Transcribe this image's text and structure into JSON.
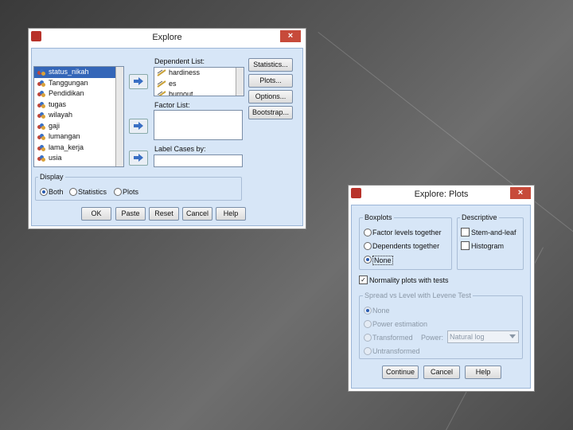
{
  "explore": {
    "title": "Explore",
    "close_label": "×",
    "variables": [
      "status_nikah",
      "Tanggungan",
      "Pendidikan",
      "tugas",
      "wilayah",
      "gaji",
      "lumangan",
      "lama_kerja",
      "usia"
    ],
    "dependent_list_label": "Dependent List:",
    "dependent_items": [
      "hardiness",
      "es",
      "burnout"
    ],
    "factor_list_label": "Factor List:",
    "label_cases_label": "Label Cases by:",
    "side_buttons": [
      "Statistics...",
      "Plots...",
      "Options...",
      "Bootstrap..."
    ],
    "display_label": "Display",
    "display_options": [
      "Both",
      "Statistics",
      "Plots"
    ],
    "footer_buttons": [
      "OK",
      "Paste",
      "Reset",
      "Cancel",
      "Help"
    ]
  },
  "plots": {
    "title": "Explore: Plots",
    "close_label": "×",
    "boxplots_label": "Boxplots",
    "boxplot_options": [
      "Factor levels together",
      "Dependents together",
      "None"
    ],
    "descriptive_label": "Descriptive",
    "descriptive_options": [
      "Stem-and-leaf",
      "Histogram"
    ],
    "normality_label": "Normality plots with tests",
    "spread_label": "Spread vs Level with Levene Test",
    "spread_options": [
      "None",
      "Power estimation",
      "Transformed",
      "Untransformed"
    ],
    "power_label": "Power:",
    "power_value": "Natural log",
    "footer_buttons": [
      "Continue",
      "Cancel",
      "Help"
    ]
  },
  "colors": {
    "accent": "#3466b8",
    "panel": "#d7e6f7",
    "close": "#c74a3a"
  }
}
